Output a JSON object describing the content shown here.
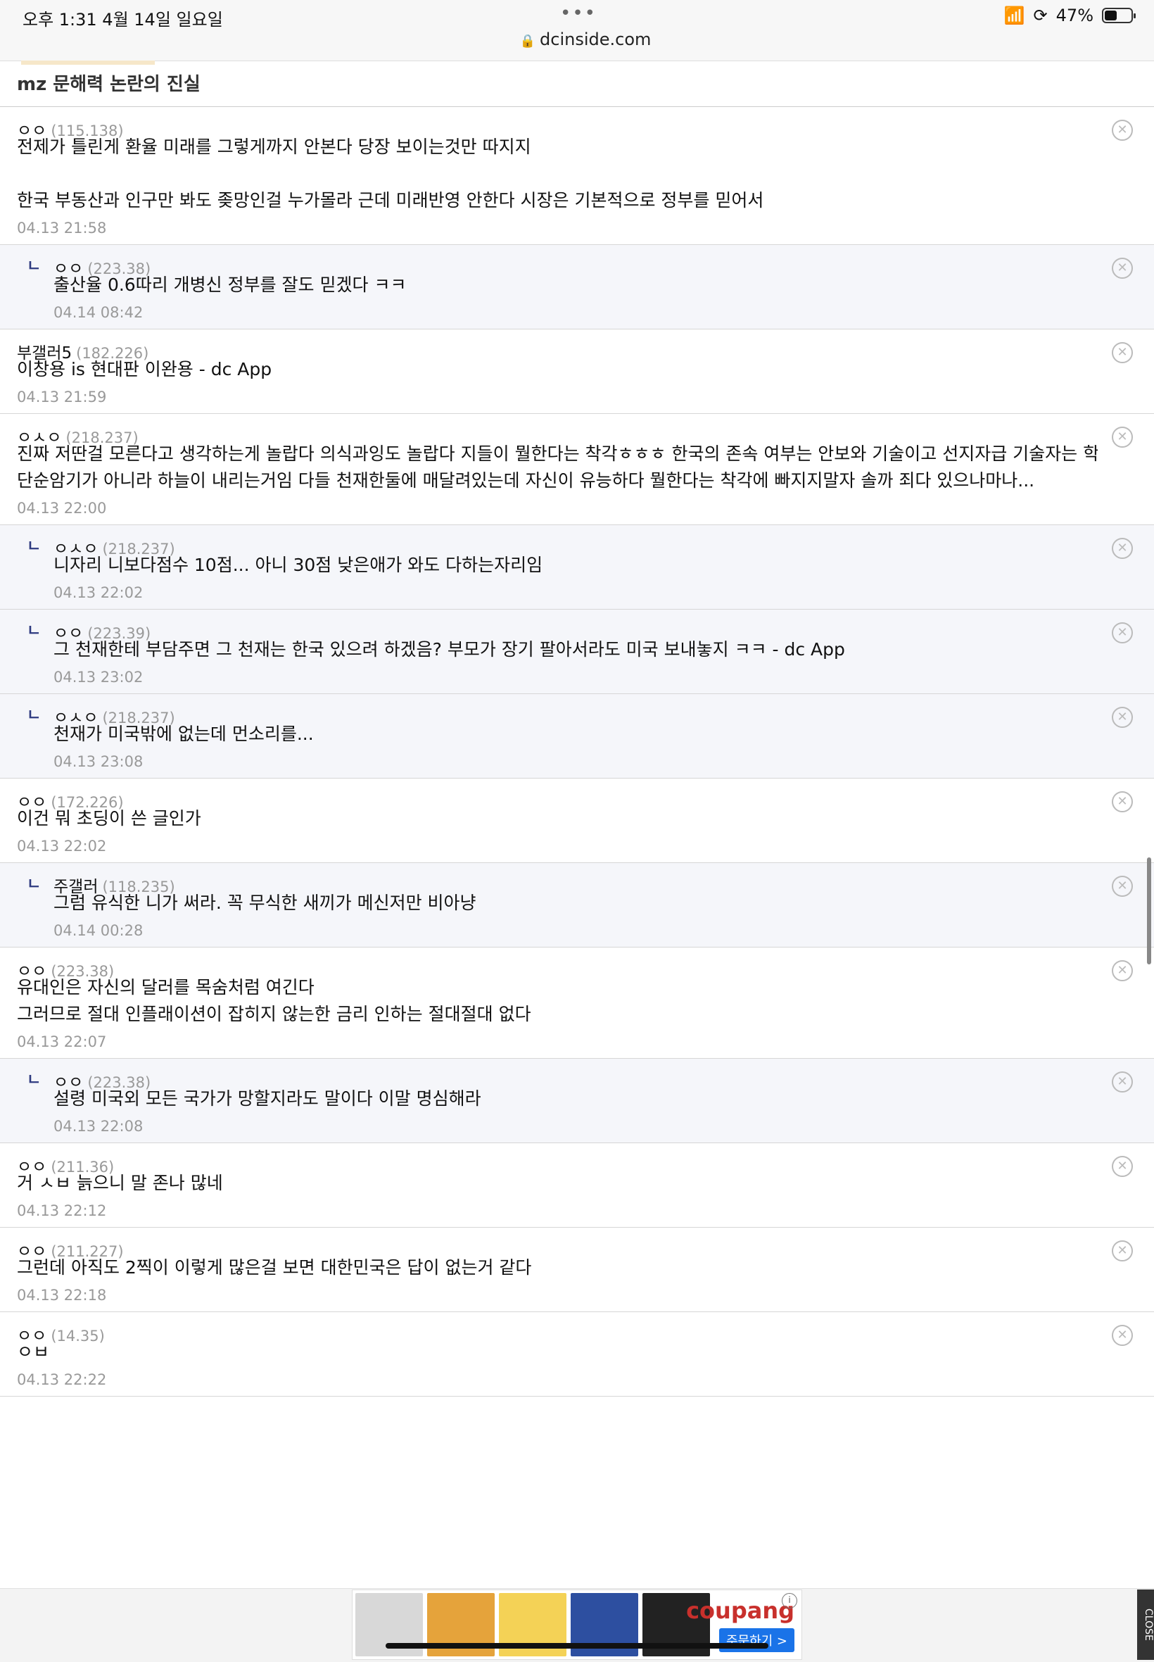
{
  "status": {
    "time": "오후 1:31   4월 14일 일요일",
    "url": "dcinside.com",
    "battery_percent": "47%",
    "battery_level": 0.47
  },
  "title": "mz 문해력 논란의 진실",
  "comments": [
    {
      "nick": "ㅇㅇ",
      "ip": "(115.138)",
      "lines": [
        "전제가 틀린게 환율 미래를 그렇게까지 안본다 당장 보이는것만 따지지",
        "",
        "한국 부동산과 인구만 봐도 좆망인걸 누가몰라 근데 미래반영 안한다 시장은 기본적으로 정부를 믿어서"
      ],
      "date": "04.13 21:58",
      "reply": false
    },
    {
      "nick": "ㅇㅇ",
      "ip": "(223.38)",
      "lines": [
        "출산율 0.6따리 개병신 정부를 잘도 믿겠다 ㅋㅋ"
      ],
      "date": "04.14 08:42",
      "reply": true
    },
    {
      "nick": "부갤러5",
      "ip": "(182.226)",
      "lines": [
        "이창용 is 현대판 이완용 - dc App"
      ],
      "date": "04.13 21:59",
      "reply": false
    },
    {
      "nick": "ㅇㅅㅇ",
      "ip": "(218.237)",
      "lines": [
        "진짜 저딴걸 모른다고 생각하는게 놀랍다 의식과잉도 놀랍다 지들이 뭘한다는 착각ㅎㅎㅎ 한국의 존속 여부는 안보와 기술이고 선지자급 기술자는 학교에서의",
        "단순암기가 아니라 하늘이 내리는거임 다들 천재한둘에 매달려있는데 자신이 유능하다 뭘한다는 착각에 빠지지말자 솔까 죄다 있으나마나..."
      ],
      "date": "04.13 22:00",
      "reply": false
    },
    {
      "nick": "ㅇㅅㅇ",
      "ip": "(218.237)",
      "lines": [
        "니자리 니보다점수 10점... 아니 30점 낮은애가 와도 다하는자리임"
      ],
      "date": "04.13 22:02",
      "reply": true
    },
    {
      "nick": "ㅇㅇ",
      "ip": "(223.39)",
      "lines": [
        "그 천재한테 부담주면 그 천재는 한국 있으려 하겠음? 부모가 장기 팔아서라도 미국 보내놓지 ㅋㅋ - dc App"
      ],
      "date": "04.13 23:02",
      "reply": true
    },
    {
      "nick": "ㅇㅅㅇ",
      "ip": "(218.237)",
      "lines": [
        "천재가 미국밖에 없는데 먼소리를..."
      ],
      "date": "04.13 23:08",
      "reply": true
    },
    {
      "nick": "ㅇㅇ",
      "ip": "(172.226)",
      "lines": [
        "이건 뭐 초딩이 쓴 글인가"
      ],
      "date": "04.13 22:02",
      "reply": false
    },
    {
      "nick": "주갤러",
      "ip": "(118.235)",
      "lines": [
        "그럼 유식한 니가 써라. 꼭 무식한 새끼가 메신저만 비아냥"
      ],
      "date": "04.14 00:28",
      "reply": true
    },
    {
      "nick": "ㅇㅇ",
      "ip": "(223.38)",
      "lines": [
        "유대인은 자신의 달러를 목숨처럼 여긴다",
        "그러므로 절대 인플래이션이 잡히지 않는한 금리 인하는 절대절대 없다"
      ],
      "date": "04.13 22:07",
      "reply": false
    },
    {
      "nick": "ㅇㅇ",
      "ip": "(223.38)",
      "lines": [
        "설령 미국외 모든 국가가 망할지라도 말이다 이말 명심해라"
      ],
      "date": "04.13 22:08",
      "reply": true
    },
    {
      "nick": "ㅇㅇ",
      "ip": "(211.36)",
      "lines": [
        "거 ㅅㅂ 늙으니 말 존나 많네"
      ],
      "date": "04.13 22:12",
      "reply": false
    },
    {
      "nick": "ㅇㅇ",
      "ip": "(211.227)",
      "lines": [
        "그런데 아직도 2찍이 이렇게 많은걸 보면 대한민국은 답이 없는거 같다"
      ],
      "date": "04.13 22:18",
      "reply": false
    },
    {
      "nick": "ㅇㅇ",
      "ip": "(14.35)",
      "lines": [
        "ㅇㅂ"
      ],
      "date": "04.13 22:22",
      "reply": false
    }
  ],
  "ad": {
    "logo": "coupang",
    "button": "주문하기 >",
    "info": "i",
    "close": "CLOSE"
  },
  "icons": {
    "remove": "close-circle-icon",
    "reply": "reply-arrow-icon"
  }
}
